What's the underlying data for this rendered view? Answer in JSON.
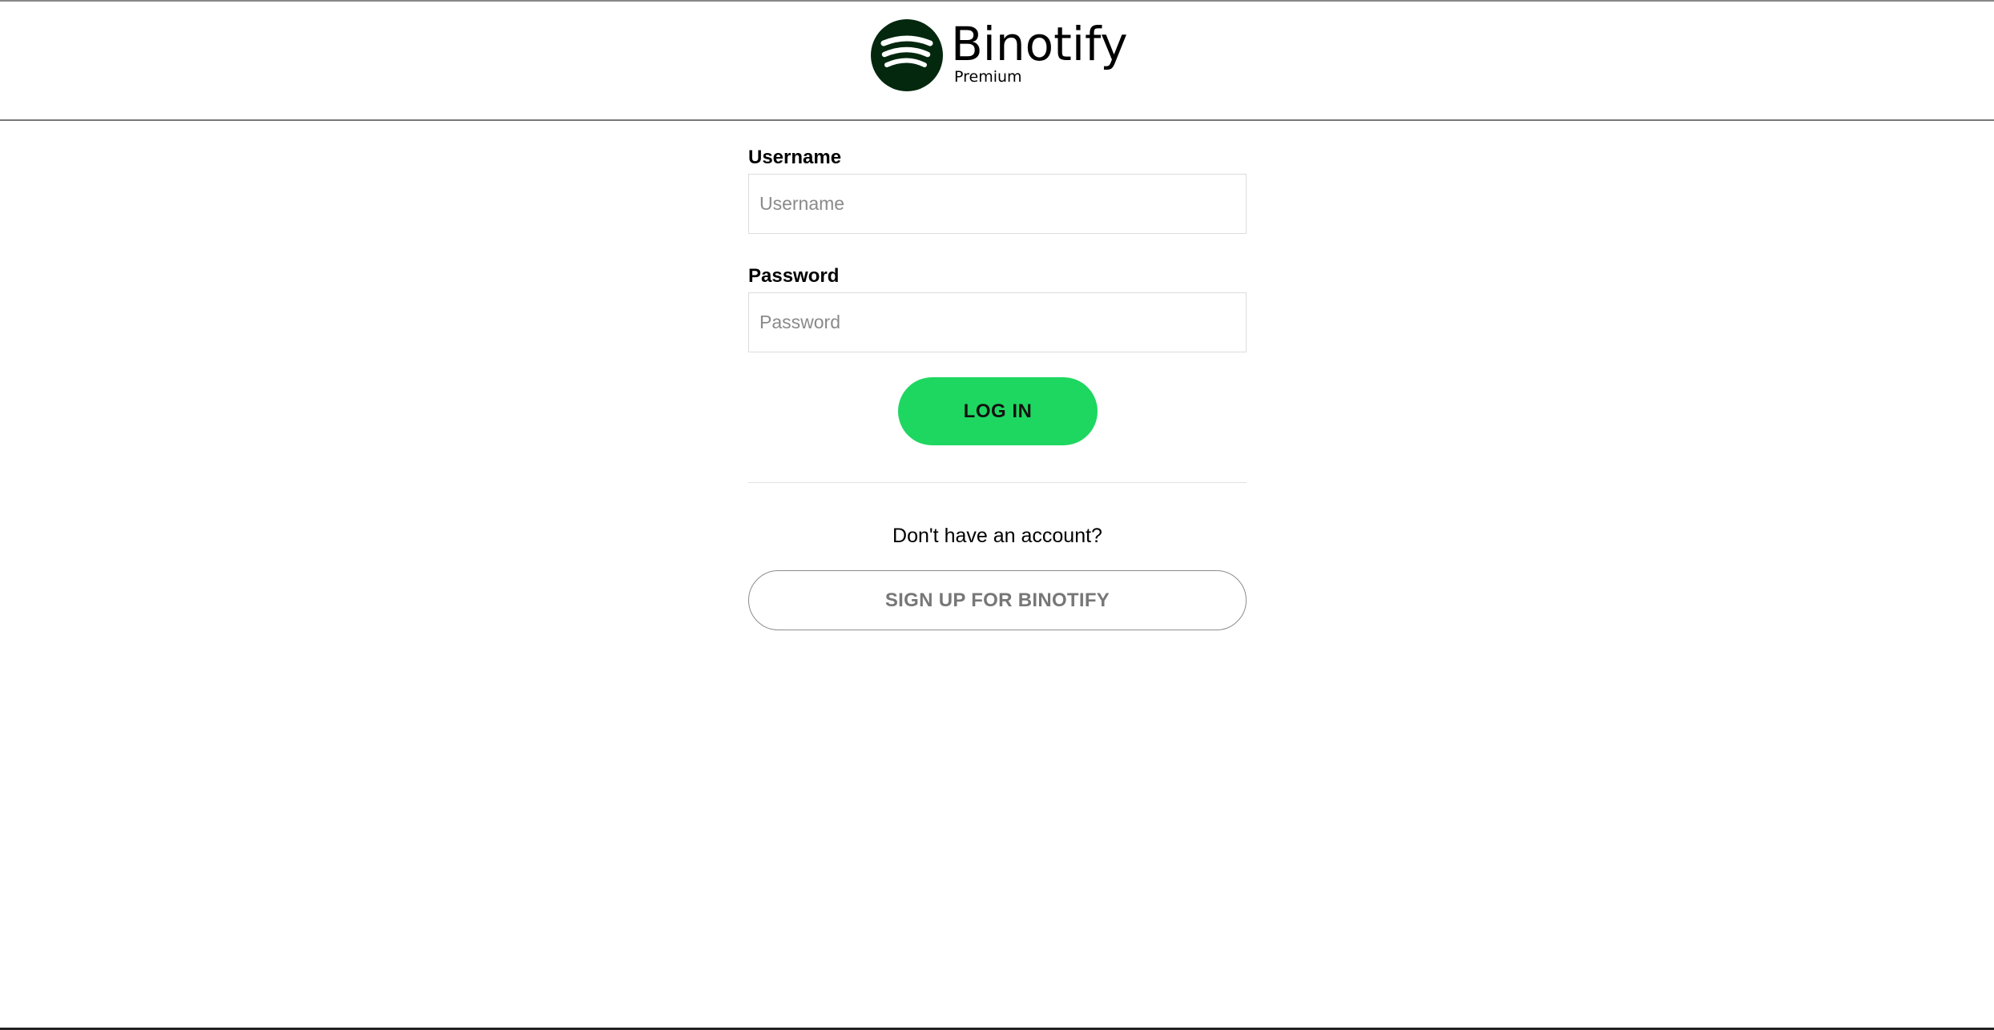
{
  "header": {
    "brand_name": "Binotify",
    "brand_tier": "Premium",
    "logo_icon": "binotify-logo-icon",
    "logo_color": "#03280e"
  },
  "login_form": {
    "username_label": "Username",
    "username_placeholder": "Username",
    "username_value": "",
    "password_label": "Password",
    "password_placeholder": "Password",
    "password_value": "",
    "login_button_label": "LOG IN",
    "login_button_color": "#1ed760"
  },
  "signup": {
    "prompt": "Don't have an account?",
    "button_label": "SIGN UP FOR BINOTIFY"
  }
}
